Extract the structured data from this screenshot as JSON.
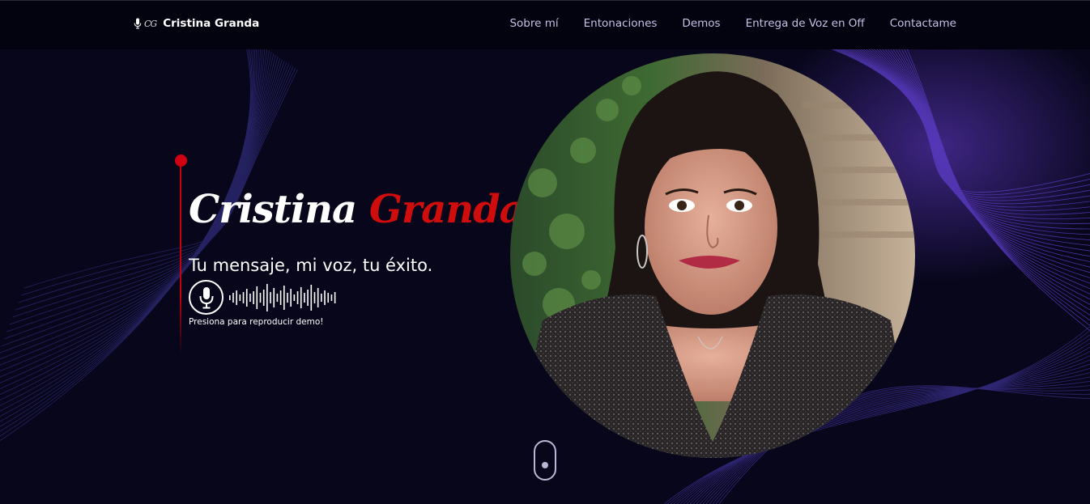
{
  "nav": {
    "brand_mark": "CG",
    "brand_name": "Cristina Granda",
    "links": [
      "Sobre mí",
      "Entonaciones",
      "Demos",
      "Entrega de Voz en Off",
      "Contactame"
    ]
  },
  "hero": {
    "title_first": "Cristina",
    "title_last": "Granda",
    "tagline": "Tu mensaje, mi voz, tu éxito.",
    "demo_hint": "Presiona para reproducir demo!"
  },
  "colors": {
    "background": "#07061a",
    "navbar": "#03030f",
    "accent_red": "#d00d0d",
    "nav_link": "#c4c2e6",
    "wave_lines": "#5b3cc4"
  },
  "icons": {
    "brand_mic": "microphone-icon",
    "demo_button": "microphone-icon",
    "scroll": "scroll-mouse-icon"
  }
}
